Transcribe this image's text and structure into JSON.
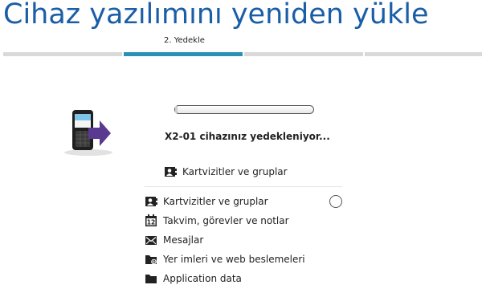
{
  "header": {
    "title": "Cihaz yazılımını yeniden yükle"
  },
  "steps": {
    "active_label": "2. Yedekle"
  },
  "status": {
    "message": "X2-01 cihazınız yedekleniyor...",
    "progress": 0.02,
    "current_item": "Kartvizitler ve gruplar"
  },
  "items": [
    {
      "label": "Kartvizitler ve gruplar",
      "icon": "contact-card-icon"
    },
    {
      "label": "Takvim, görevler ve notlar",
      "icon": "calendar-icon"
    },
    {
      "label": "Mesajlar",
      "icon": "envelope-icon"
    },
    {
      "label": "Yer imleri ve web beslemeleri",
      "icon": "bookmark-folder-icon"
    },
    {
      "label": "Application data",
      "icon": "folder-icon"
    }
  ],
  "colors": {
    "title": "#1a5ea8",
    "step_active": "#2a91b4",
    "step_inactive": "#d9d9d9",
    "arrow": "#5a3a91"
  }
}
